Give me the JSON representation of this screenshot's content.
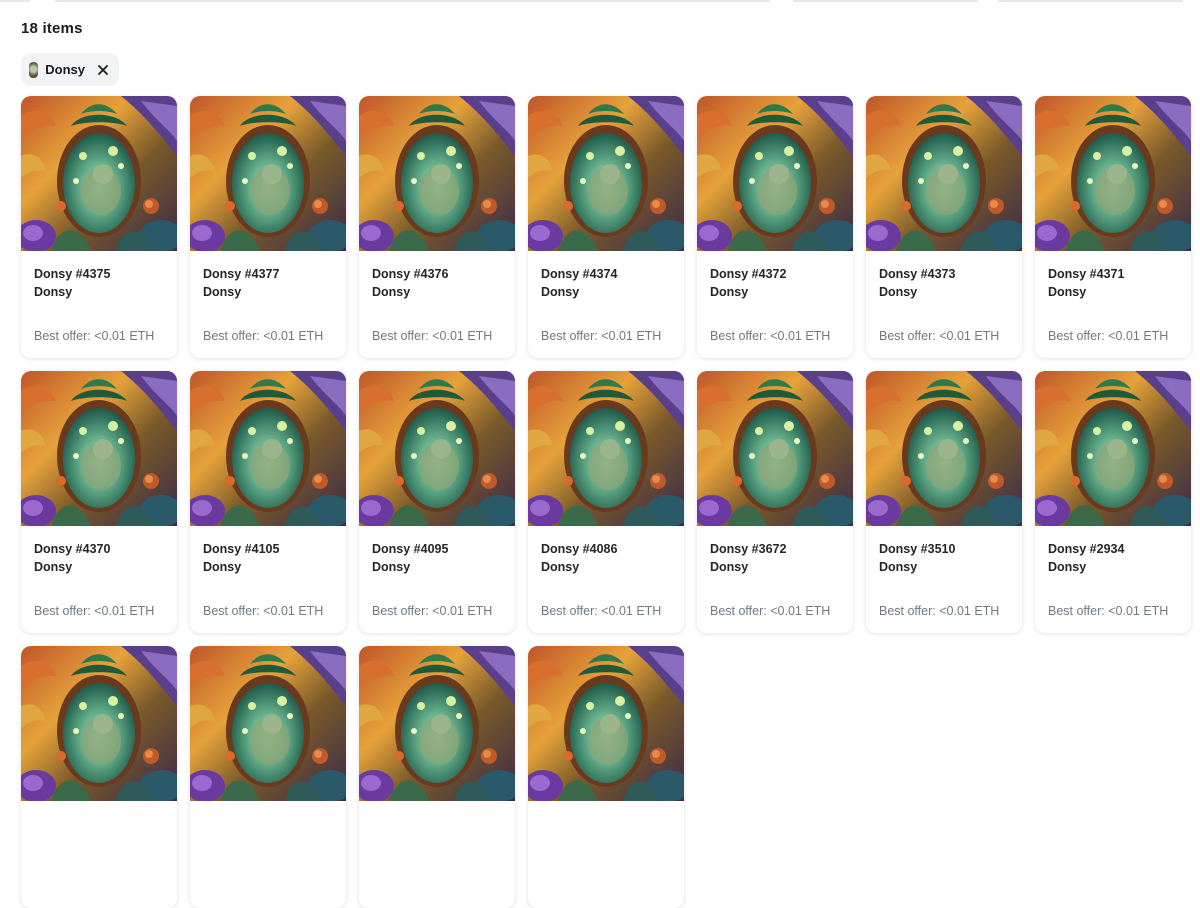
{
  "header": {
    "items_count": "18 items"
  },
  "filter_chip": {
    "label": "Donsy",
    "close_icon": "close-icon"
  },
  "cards": [
    {
      "title": "Donsy #4375",
      "collection": "Donsy",
      "offer": "Best offer: <0.01 ETH"
    },
    {
      "title": "Donsy #4377",
      "collection": "Donsy",
      "offer": "Best offer: <0.01 ETH"
    },
    {
      "title": "Donsy #4376",
      "collection": "Donsy",
      "offer": "Best offer: <0.01 ETH"
    },
    {
      "title": "Donsy #4374",
      "collection": "Donsy",
      "offer": "Best offer: <0.01 ETH"
    },
    {
      "title": "Donsy #4372",
      "collection": "Donsy",
      "offer": "Best offer: <0.01 ETH"
    },
    {
      "title": "Donsy #4373",
      "collection": "Donsy",
      "offer": "Best offer: <0.01 ETH"
    },
    {
      "title": "Donsy #4371",
      "collection": "Donsy",
      "offer": "Best offer: <0.01 ETH"
    },
    {
      "title": "Donsy #4370",
      "collection": "Donsy",
      "offer": "Best offer: <0.01 ETH"
    },
    {
      "title": "Donsy #4105",
      "collection": "Donsy",
      "offer": "Best offer: <0.01 ETH"
    },
    {
      "title": "Donsy #4095",
      "collection": "Donsy",
      "offer": "Best offer: <0.01 ETH"
    },
    {
      "title": "Donsy #4086",
      "collection": "Donsy",
      "offer": "Best offer: <0.01 ETH"
    },
    {
      "title": "Donsy #3672",
      "collection": "Donsy",
      "offer": "Best offer: <0.01 ETH"
    },
    {
      "title": "Donsy #3510",
      "collection": "Donsy",
      "offer": "Best offer: <0.01 ETH"
    },
    {
      "title": "Donsy #2934",
      "collection": "Donsy",
      "offer": "Best offer: <0.01 ETH"
    },
    {
      "title": "",
      "collection": "",
      "offer": ""
    },
    {
      "title": "",
      "collection": "",
      "offer": ""
    },
    {
      "title": "",
      "collection": "",
      "offer": ""
    },
    {
      "title": "",
      "collection": "",
      "offer": ""
    }
  ],
  "colors": {
    "card_border_shadow": "#e5e8eb",
    "chip_background": "#f2f3f5",
    "offer_text": "#707a83",
    "title_text": "#262626"
  }
}
